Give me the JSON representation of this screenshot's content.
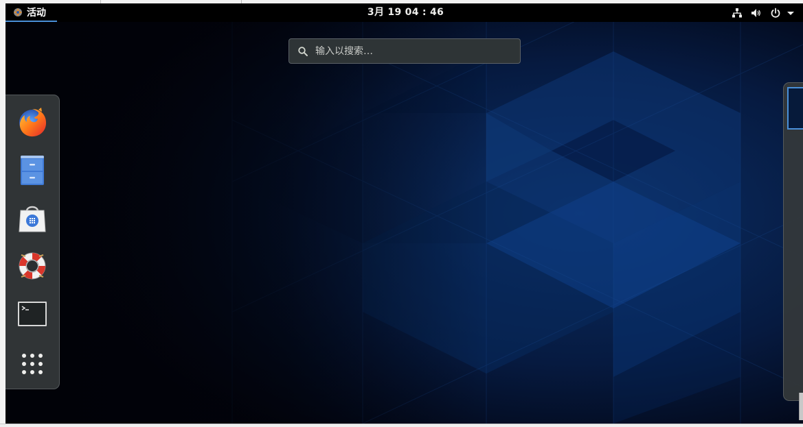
{
  "topbar": {
    "activities_label": "活动",
    "clock": "3月 19  04 : 46",
    "tray_icons": [
      "network-wired-icon",
      "volume-icon",
      "power-icon",
      "system-menu-arrow-icon"
    ]
  },
  "search": {
    "placeholder": "输入以搜索…",
    "value": ""
  },
  "dash": {
    "items": [
      {
        "name": "firefox",
        "icon": "firefox-icon"
      },
      {
        "name": "files",
        "icon": "file-cabinet-icon"
      },
      {
        "name": "software",
        "icon": "software-bag-icon"
      },
      {
        "name": "help",
        "icon": "lifebuoy-icon"
      },
      {
        "name": "terminal",
        "icon": "terminal-icon"
      },
      {
        "name": "show-applications",
        "icon": "app-grid-icon"
      }
    ]
  },
  "colors": {
    "accent": "#4a90d9",
    "topbar_bg": "#000000",
    "dash_bg": "#34383a",
    "wallpaper_dark": "#02030d",
    "wallpaper_blue": "#0a3a7a"
  },
  "workspaces": {
    "count": 1,
    "active": 1
  }
}
